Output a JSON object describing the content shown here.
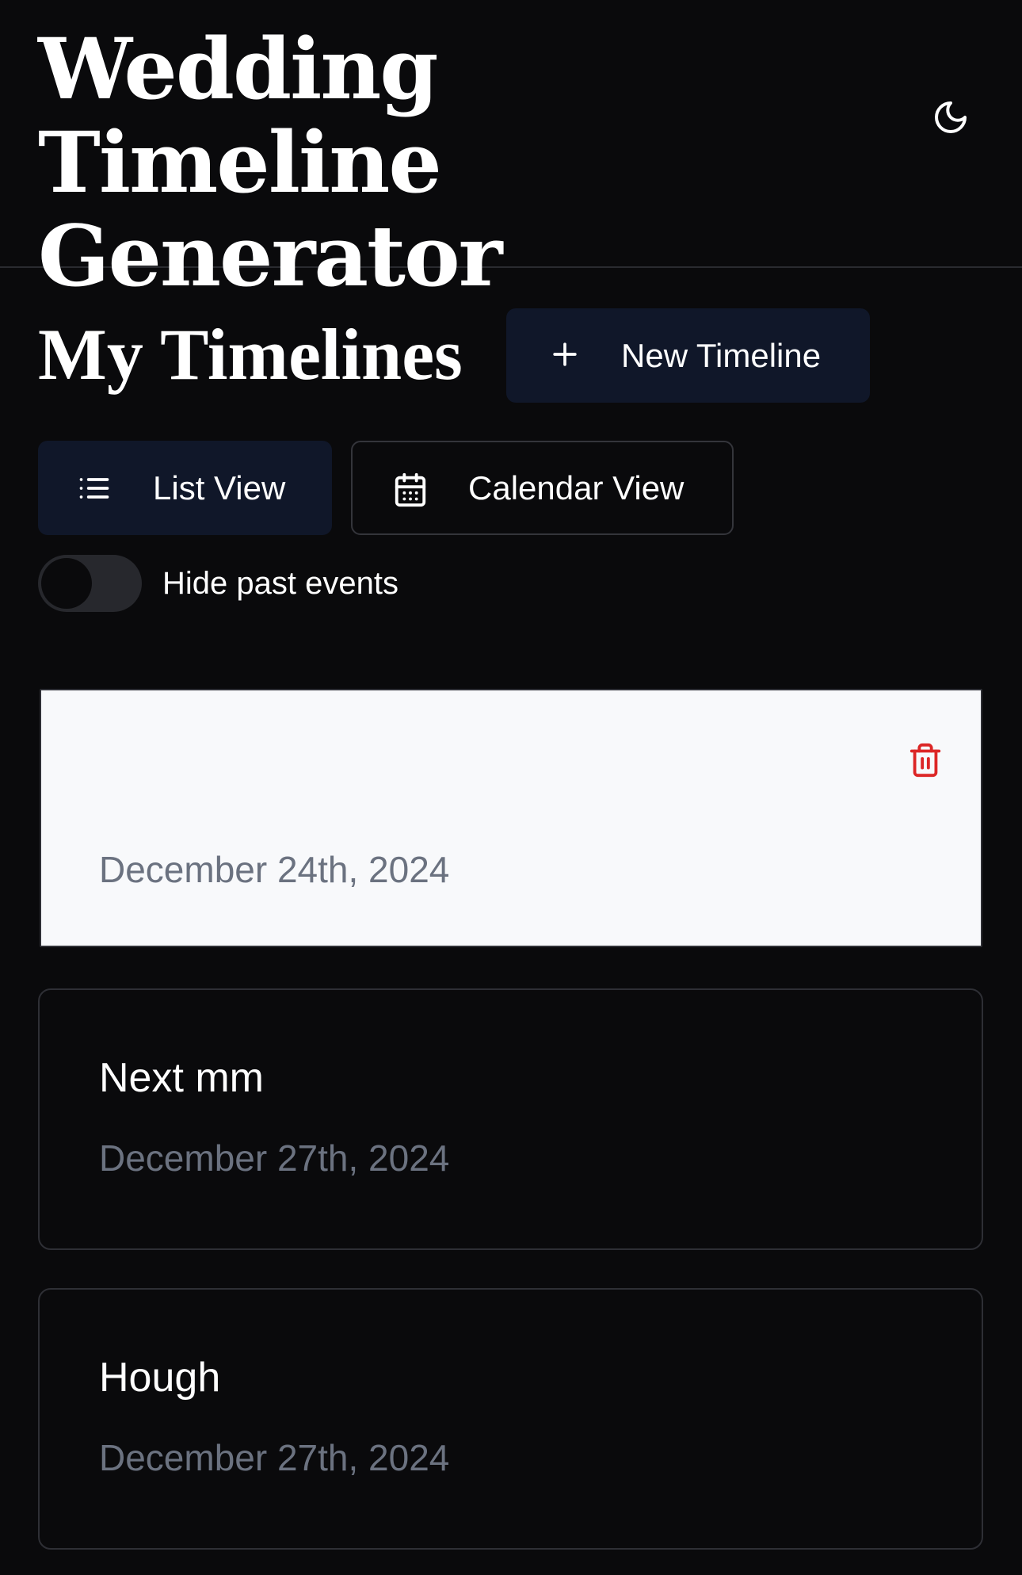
{
  "header": {
    "title": "Wedding Timeline Generator",
    "theme_toggle_icon": "moon-icon"
  },
  "main": {
    "title": "My Timelines",
    "new_button": {
      "label": "New Timeline",
      "icon": "plus-icon"
    },
    "views": [
      {
        "label": "List View",
        "icon": "list-icon",
        "active": true
      },
      {
        "label": "Calendar View",
        "icon": "calendar-icon",
        "active": false
      }
    ],
    "hide_past": {
      "label": "Hide past events",
      "checked": false
    }
  },
  "timelines": [
    {
      "title": "",
      "date": "December 24th, 2024",
      "selected": true,
      "delete_icon": "trash-icon"
    },
    {
      "title": "Next mm",
      "date": "December 27th, 2024",
      "selected": false
    },
    {
      "title": "Hough",
      "date": "December 27th, 2024",
      "selected": false
    }
  ],
  "colors": {
    "background": "#0a0a0c",
    "button_primary": "#101729",
    "card_selected_bg": "#f8f9fb",
    "delete_red": "#dc2626",
    "muted_text": "#6b7280"
  }
}
